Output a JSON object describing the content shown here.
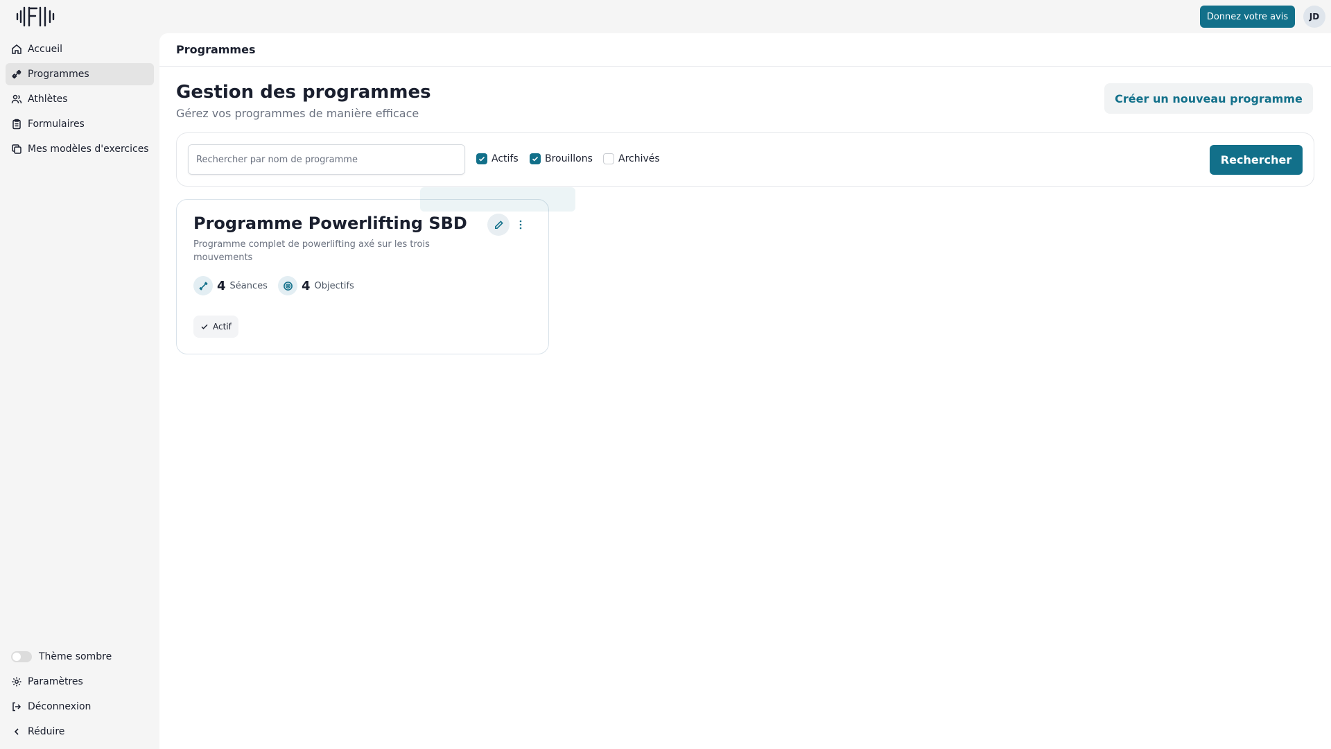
{
  "app": {
    "feedback_label": "Donnez votre avis",
    "avatar_initials": "JD",
    "accent_color": "#12708a"
  },
  "sidebar": {
    "items": [
      {
        "label": "Accueil",
        "icon": "home-icon"
      },
      {
        "label": "Programmes",
        "icon": "dumbbell-icon",
        "active": true
      },
      {
        "label": "Athlètes",
        "icon": "users-icon"
      },
      {
        "label": "Formulaires",
        "icon": "clipboard-icon"
      },
      {
        "label": "Mes modèles d'exercices",
        "icon": "copy-icon"
      }
    ],
    "bottom": {
      "theme_label": "Thème sombre",
      "settings_label": "Paramètres",
      "logout_label": "Déconnexion",
      "collapse_label": "Réduire"
    }
  },
  "main": {
    "header_title": "Programmes",
    "page_title": "Gestion des programmes",
    "page_subtitle": "Gérez vos programmes de manière efficace",
    "create_label": "Créer un nouveau programme"
  },
  "filters": {
    "search_placeholder": "Rechercher par nom de programme",
    "search_value": "",
    "options": [
      {
        "label": "Actifs",
        "checked": true
      },
      {
        "label": "Brouillons",
        "checked": true
      },
      {
        "label": "Archivés",
        "checked": false
      }
    ],
    "search_button": "Rechercher"
  },
  "programs": [
    {
      "title": "Programme Powerlifting SBD",
      "description": "Programme complet de powerlifting axé sur les trois mouvements",
      "sessions_count": "4",
      "sessions_label": "Séances",
      "goals_count": "4",
      "goals_label": "Objectifs",
      "status": "Actif"
    }
  ]
}
